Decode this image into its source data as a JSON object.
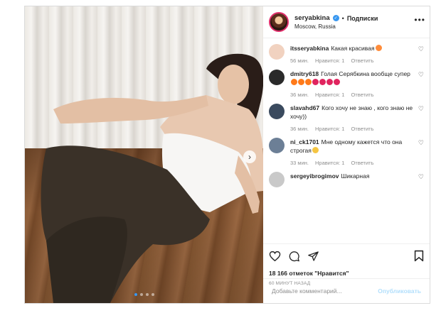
{
  "post": {
    "username": "seryabkina",
    "dot": "•",
    "follow_label": "Подписки",
    "location": "Moscow, Russia",
    "more": "•••",
    "likes": "18 166 отметок \"Нравится\"",
    "time_ago": "60 МИНУТ НАЗАД",
    "add_comment_placeholder": "Добавьте комментарий...",
    "publish_label": "Опубликовать",
    "carousel": {
      "slides": 4,
      "active_index": 0
    }
  },
  "comments": [
    {
      "user": "itsseryabkina",
      "text": "Какая красивая",
      "emoji": [
        "#ff8c3a"
      ],
      "time": "56 мин.",
      "likes": "Нравится: 1",
      "reply": "Ответить"
    },
    {
      "user": "dmitry618",
      "text": "Голая Серябкина вообще супер",
      "emoji": [
        "#ff7a1a",
        "#ff7a1a",
        "#ff7a1a",
        "#e0245e",
        "#e0245e",
        "#e0245e",
        "#e0245e"
      ],
      "time": "36 мин.",
      "likes": "Нравится: 1",
      "reply": "Ответить"
    },
    {
      "user": "slavahd67",
      "text": "Кого хочу не знаю , кого знаю не хочу))",
      "emoji": [],
      "time": "36 мин.",
      "likes": "Нравится: 1",
      "reply": "Ответить"
    },
    {
      "user": "ni_ck1701",
      "text": "Мне одному кажется что она строгая",
      "emoji": [
        "#f5c542"
      ],
      "time": "33 мин.",
      "likes": "Нравится: 1",
      "reply": "Ответить"
    },
    {
      "user": "sergeyibrogimov",
      "text": "Шикарная",
      "emoji": [],
      "time": "",
      "likes": "",
      "reply": ""
    }
  ],
  "colors": {
    "verified": "#3897f0",
    "meta_gray": "#8e8e8e",
    "publish_disabled": "#b2dffc",
    "heart_red": "#e0245e"
  },
  "icons": [
    "verified-icon",
    "more-icon",
    "heart-icon",
    "comment-icon",
    "share-icon",
    "bookmark-icon",
    "chevron-right-icon"
  ]
}
